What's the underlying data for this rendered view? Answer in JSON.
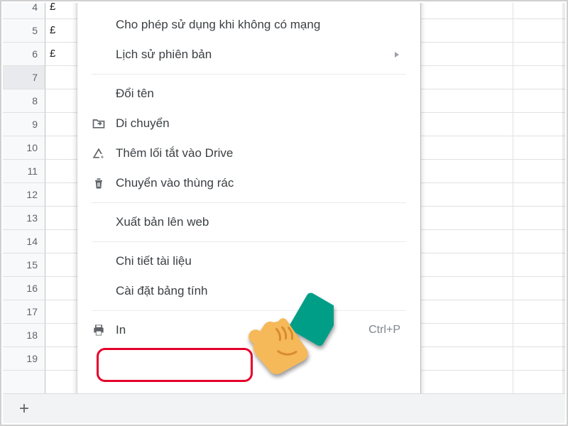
{
  "rows": [
    {
      "n": "4",
      "val": "£"
    },
    {
      "n": "5",
      "val": "£"
    },
    {
      "n": "6",
      "val": "£"
    },
    {
      "n": "7",
      "val": "",
      "sel": true
    },
    {
      "n": "8",
      "val": ""
    },
    {
      "n": "9",
      "val": ""
    },
    {
      "n": "10",
      "val": ""
    },
    {
      "n": "11",
      "val": ""
    },
    {
      "n": "12",
      "val": ""
    },
    {
      "n": "13",
      "val": ""
    },
    {
      "n": "14",
      "val": ""
    },
    {
      "n": "15",
      "val": ""
    },
    {
      "n": "16",
      "val": ""
    },
    {
      "n": "17",
      "val": ""
    },
    {
      "n": "18",
      "val": ""
    },
    {
      "n": "19",
      "val": ""
    },
    {
      "n": "",
      "val": ""
    }
  ],
  "menu": {
    "offline": "Cho phép sử dụng khi không có mạng",
    "history": "Lịch sử phiên bản",
    "rename": "Đổi tên",
    "move": "Di chuyển",
    "shortcut": "Thêm lối tắt vào Drive",
    "trash": "Chuyển vào thùng rác",
    "publish": "Xuất bản lên web",
    "details": "Chi tiết tài liệu",
    "settings": "Cài đặt bảng tính",
    "print": "In",
    "print_key": "Ctrl+P"
  },
  "addsheet": "+"
}
